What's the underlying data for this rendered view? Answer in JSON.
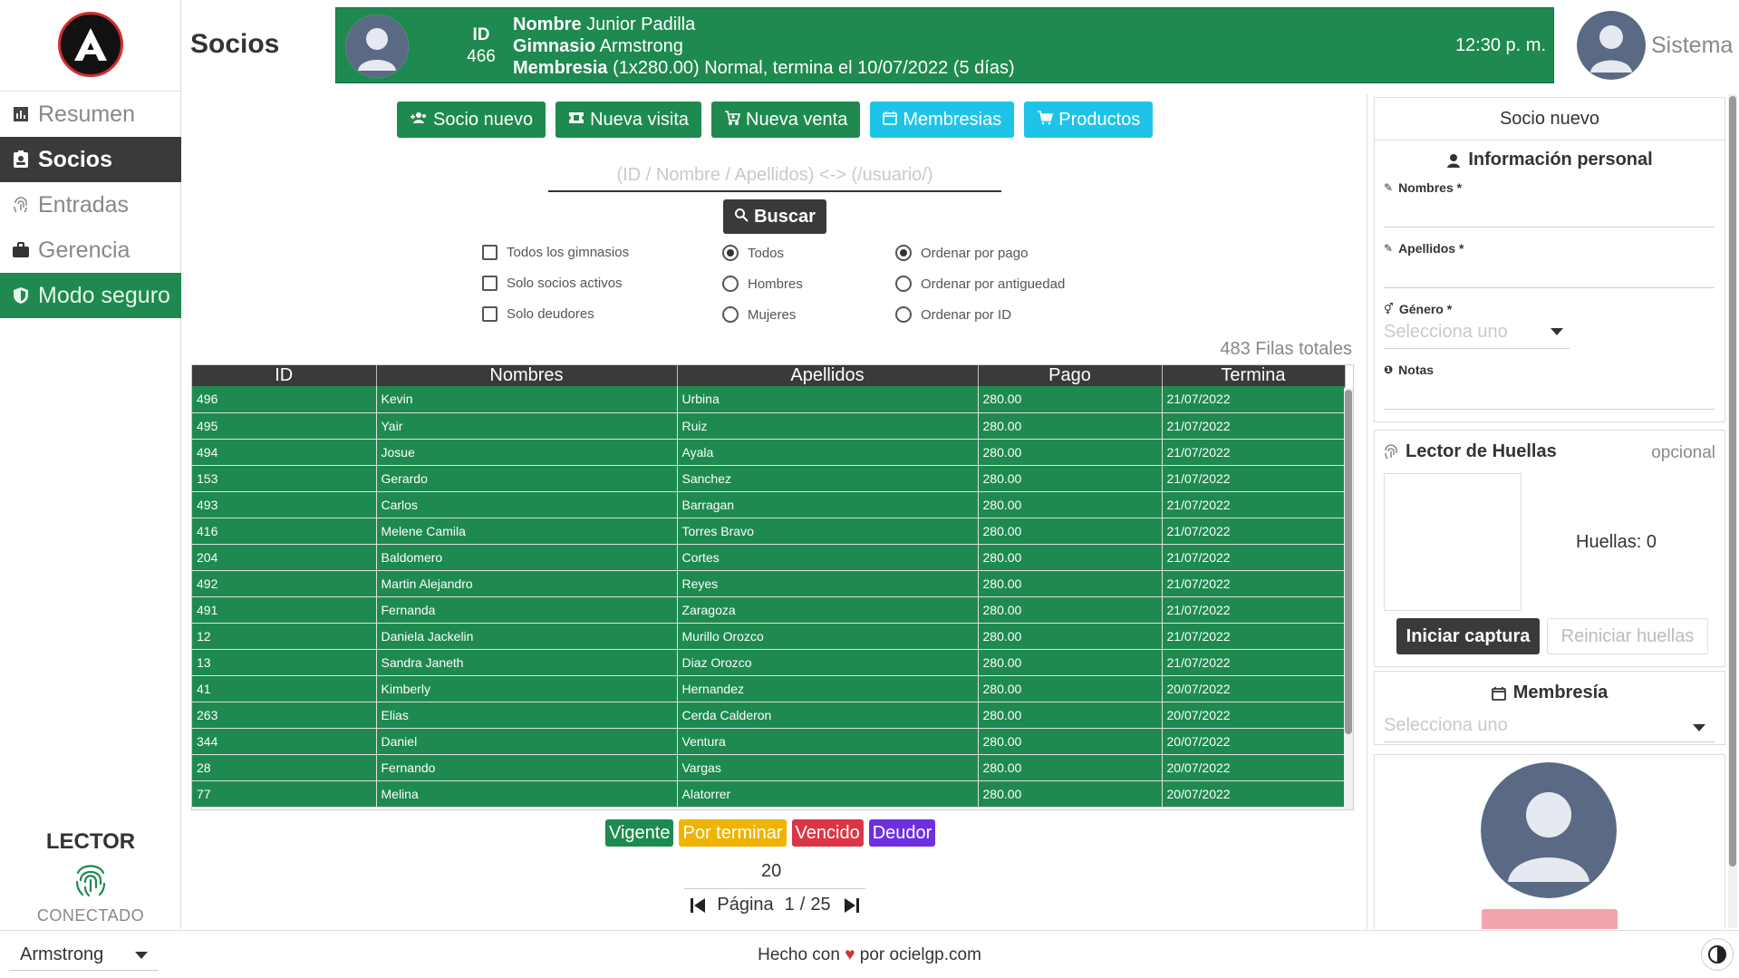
{
  "sidebar": {
    "items": [
      {
        "label": "Resumen",
        "icon": "bar-chart-icon"
      },
      {
        "label": "Socios",
        "icon": "id-badge-icon"
      },
      {
        "label": "Entradas",
        "icon": "fingerprint-icon"
      },
      {
        "label": "Gerencia",
        "icon": "briefcase-icon"
      },
      {
        "label": "Modo seguro",
        "icon": "shield-icon"
      }
    ],
    "active": "Socios",
    "reader": {
      "title": "LECTOR",
      "status": "CONECTADO"
    }
  },
  "header": {
    "title": "Socios",
    "member": {
      "id_label": "ID",
      "id": "466",
      "name_label": "Nombre",
      "name": "Junior Padilla",
      "gym_label": "Gimnasio",
      "gym": "Armstrong",
      "membership_label": "Membresia",
      "membership": "(1x280.00) Normal, termina el 10/07/2022 (5 días)"
    },
    "time": "12:30 p. m.",
    "user": "Sistema"
  },
  "actions": [
    {
      "label": "Socio nuevo",
      "icon": "user-plus-icon",
      "color": "#1e8a4f"
    },
    {
      "label": "Nueva visita",
      "icon": "ticket-icon",
      "color": "#1e8a4f"
    },
    {
      "label": "Nueva venta",
      "icon": "cart-plus-icon",
      "color": "#1e8a4f"
    },
    {
      "label": "Membresias",
      "icon": "calendar-icon",
      "color": "#1ec4e8"
    },
    {
      "label": "Productos",
      "icon": "cart-icon",
      "color": "#1ec4e8"
    }
  ],
  "search": {
    "placeholder": "(ID / Nombre / Apellidos) <-> (/usuario/)",
    "button": "Buscar"
  },
  "filters": {
    "checkboxes": [
      "Todos los gimnasios",
      "Solo socios activos",
      "Solo deudores"
    ],
    "gender": {
      "options": [
        "Todos",
        "Hombres",
        "Mujeres"
      ],
      "selected": "Todos"
    },
    "order": {
      "options": [
        "Ordenar por pago",
        "Ordenar por antiguedad",
        "Ordenar por ID"
      ],
      "selected": "Ordenar por pago"
    }
  },
  "table": {
    "total": "483 Filas totales",
    "columns": [
      "ID",
      "Nombres",
      "Apellidos",
      "Pago",
      "Termina"
    ],
    "rows": [
      [
        "496",
        "Kevin",
        "Urbina",
        "280.00",
        "21/07/2022"
      ],
      [
        "495",
        "Yair",
        "Ruiz",
        "280.00",
        "21/07/2022"
      ],
      [
        "494",
        "Josue",
        "Ayala",
        "280.00",
        "21/07/2022"
      ],
      [
        "153",
        "Gerardo",
        "Sanchez",
        "280.00",
        "21/07/2022"
      ],
      [
        "493",
        "Carlos",
        "Barragan",
        "280.00",
        "21/07/2022"
      ],
      [
        "416",
        "Melene Camila",
        "Torres Bravo",
        "280.00",
        "21/07/2022"
      ],
      [
        "204",
        "Baldomero",
        "Cortes",
        "280.00",
        "21/07/2022"
      ],
      [
        "492",
        "Martin Alejandro",
        "Reyes",
        "280.00",
        "21/07/2022"
      ],
      [
        "491",
        "Fernanda",
        "Zaragoza",
        "280.00",
        "21/07/2022"
      ],
      [
        "12",
        "Daniela Jackelin",
        "Murillo Orozco",
        "280.00",
        "21/07/2022"
      ],
      [
        "13",
        "Sandra Janeth",
        "Diaz Orozco",
        "280.00",
        "21/07/2022"
      ],
      [
        "41",
        "Kimberly",
        "Hernandez",
        "280.00",
        "20/07/2022"
      ],
      [
        "263",
        "Elias",
        "Cerda Calderon",
        "280.00",
        "20/07/2022"
      ],
      [
        "344",
        "Daniel",
        "Ventura",
        "280.00",
        "20/07/2022"
      ],
      [
        "28",
        "Fernando",
        "Vargas",
        "280.00",
        "20/07/2022"
      ],
      [
        "77",
        "Melina",
        "Alatorrer",
        "280.00",
        "20/07/2022"
      ]
    ],
    "row_color": "#1e8a4f"
  },
  "legend": [
    {
      "label": "Vigente",
      "color": "#1e8a4f"
    },
    {
      "label": "Por terminar",
      "color": "#f0b400"
    },
    {
      "label": "Vencido",
      "color": "#dc3545"
    },
    {
      "label": "Deudor",
      "color": "#6f2fe0"
    }
  ],
  "pagination": {
    "page_size": "20",
    "label": "Página",
    "current": "1",
    "separator": "/",
    "total": "25"
  },
  "new_member": {
    "title": "Socio nuevo",
    "personal": {
      "title": "Información personal",
      "fields": [
        {
          "label": "Nombres *",
          "value": ""
        },
        {
          "label": "Apellidos *",
          "value": ""
        },
        {
          "label": "Género *",
          "value": "Selecciona uno"
        },
        {
          "label": "Notas",
          "value": ""
        }
      ]
    },
    "fingerprint": {
      "title": "Lector de Huellas",
      "optional": "opcional",
      "count": "Huellas: 0",
      "capture_button": "Iniciar captura",
      "reset_button": "Reiniciar huellas"
    },
    "membership": {
      "title": "Membresía",
      "placeholder": "Selecciona uno"
    }
  },
  "footer": {
    "gym": "Armstrong",
    "made_with": "Hecho con",
    "heart": "♥",
    "by": "por ocielgp.com"
  }
}
